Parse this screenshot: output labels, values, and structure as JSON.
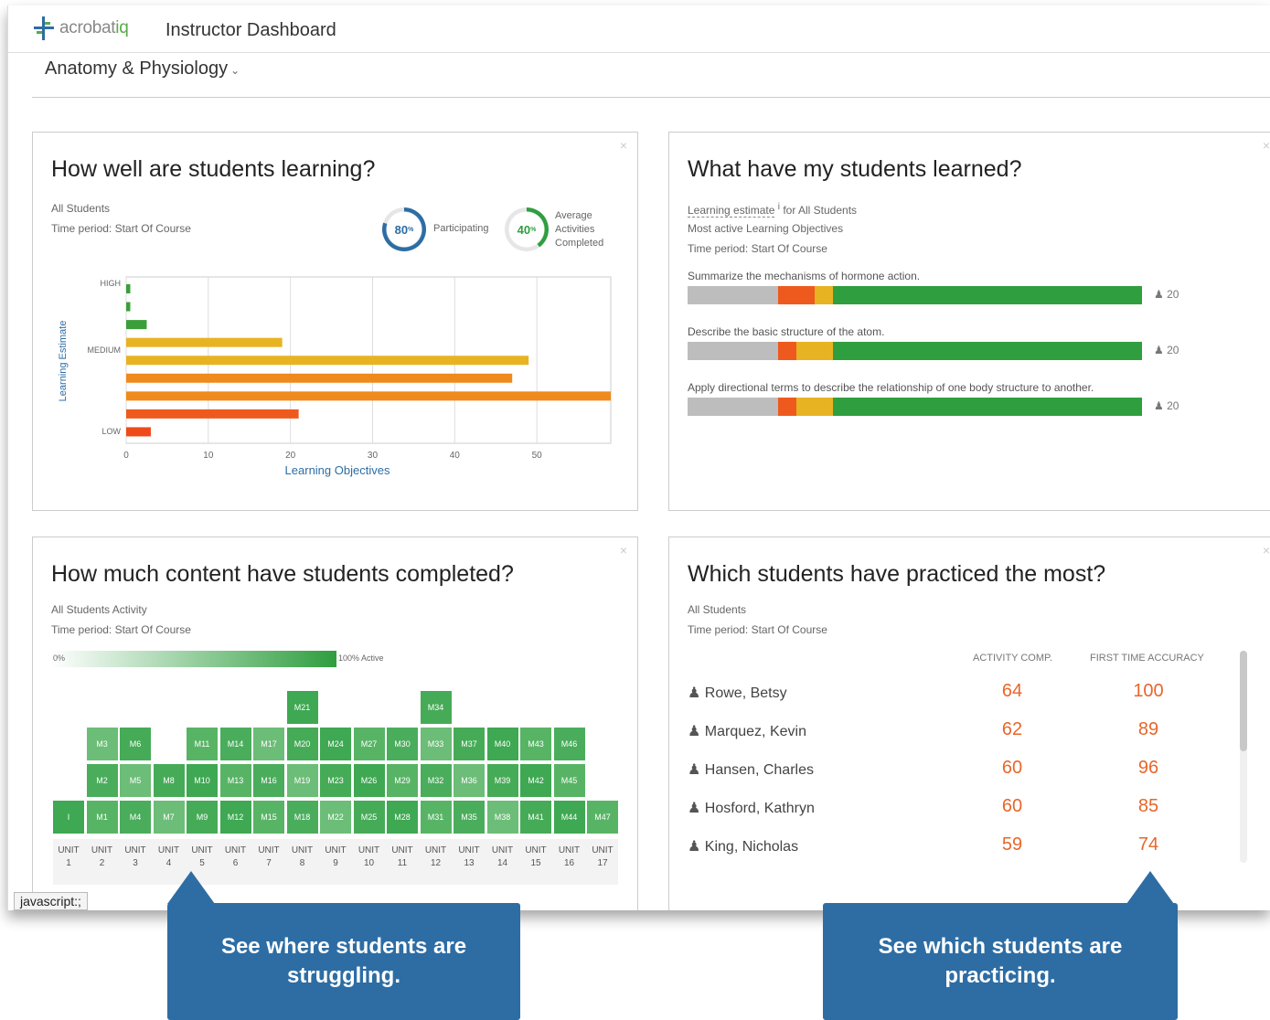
{
  "header": {
    "logo_text_a": "acrobat",
    "logo_text_b": "iq",
    "app_title": "Instructor Dashboard",
    "course": "Anatomy & Physiology",
    "course_caret": "⌄"
  },
  "learning_panel": {
    "title": "How well are students learning?",
    "filter": "All Students",
    "period": "Time period: Start Of Course",
    "participating": {
      "value": "80",
      "unit": "%",
      "label": "Participating",
      "fraction": 0.8
    },
    "activities": {
      "value": "40",
      "unit": "%",
      "label": "Average Activities Completed",
      "fraction": 0.4
    },
    "close": "×"
  },
  "chart_data": {
    "type": "bar",
    "orientation": "horizontal",
    "xlabel": "Learning Objectives",
    "ylabel": "Learning Estimate",
    "x_ticks": [
      "0",
      "10",
      "20",
      "30",
      "40",
      "50"
    ],
    "xlim": [
      0,
      59
    ],
    "y_tick_labels": [
      "HIGH",
      "MEDIUM",
      "LOW"
    ],
    "grid": true,
    "bars": [
      {
        "value": 0.5,
        "color": "#3a9f3a"
      },
      {
        "value": 0.5,
        "color": "#3a9f3a"
      },
      {
        "value": 2.5,
        "color": "#3a9f3a"
      },
      {
        "value": 19,
        "color": "#e8b323"
      },
      {
        "value": 49,
        "color": "#e8b323"
      },
      {
        "value": 47,
        "color": "#f08a1c"
      },
      {
        "value": 59,
        "color": "#f08a1c"
      },
      {
        "value": 21,
        "color": "#ee5a1e"
      },
      {
        "value": 3,
        "color": "#ee4a1a"
      }
    ]
  },
  "learned_panel": {
    "title": "What have my students learned?",
    "estimate_label": "Learning estimate",
    "info": "i",
    "for_label": "for All Students",
    "subtitle": "Most active Learning Objectives",
    "period": "Time period: Start Of Course",
    "close": "×",
    "objectives": [
      {
        "label": "Summarize the mechanisms of hormone action.",
        "count": "20",
        "segments": [
          0.2,
          0.08,
          0.04,
          0.68
        ]
      },
      {
        "label": "Describe the basic structure of the atom.",
        "count": "20",
        "segments": [
          0.2,
          0.04,
          0.08,
          0.68
        ]
      },
      {
        "label": "Apply directional terms to describe the relationship of one body structure to another.",
        "count": "20",
        "segments": [
          0.2,
          0.04,
          0.08,
          0.68
        ]
      }
    ],
    "segment_colors": [
      "#bdbdbd",
      "#ee5a1e",
      "#e8b323",
      "#2f9e3f"
    ]
  },
  "content_panel": {
    "title": "How much content have students completed?",
    "filter": "All Students Activity",
    "period": "Time period: Start Of Course",
    "legend_min": "0%",
    "legend_max": "100% Active",
    "close": "×",
    "units": [
      {
        "label": "UNIT",
        "num": "1",
        "modules": [
          "I"
        ]
      },
      {
        "label": "UNIT",
        "num": "2",
        "modules": [
          "M1",
          "M2",
          "M3"
        ]
      },
      {
        "label": "UNIT",
        "num": "3",
        "modules": [
          "M4",
          "M5",
          "M6"
        ]
      },
      {
        "label": "UNIT",
        "num": "4",
        "modules": [
          "M7",
          "M8"
        ]
      },
      {
        "label": "UNIT",
        "num": "5",
        "modules": [
          "M9",
          "M10",
          "M11"
        ]
      },
      {
        "label": "UNIT",
        "num": "6",
        "modules": [
          "M12",
          "M13",
          "M14"
        ]
      },
      {
        "label": "UNIT",
        "num": "7",
        "modules": [
          "M15",
          "M16",
          "M17"
        ]
      },
      {
        "label": "UNIT",
        "num": "8",
        "modules": [
          "M18",
          "M19",
          "M20",
          "M21"
        ]
      },
      {
        "label": "UNIT",
        "num": "9",
        "modules": [
          "M22",
          "M23",
          "M24"
        ]
      },
      {
        "label": "UNIT",
        "num": "10",
        "modules": [
          "M25",
          "M26",
          "M27"
        ]
      },
      {
        "label": "UNIT",
        "num": "11",
        "modules": [
          "M28",
          "M29",
          "M30"
        ]
      },
      {
        "label": "UNIT",
        "num": "12",
        "modules": [
          "M31",
          "M32",
          "M33",
          "M34"
        ]
      },
      {
        "label": "UNIT",
        "num": "13",
        "modules": [
          "M35",
          "M36",
          "M37"
        ]
      },
      {
        "label": "UNIT",
        "num": "14",
        "modules": [
          "M38",
          "M39",
          "M40"
        ]
      },
      {
        "label": "UNIT",
        "num": "15",
        "modules": [
          "M41",
          "M42",
          "M43"
        ]
      },
      {
        "label": "UNIT",
        "num": "16",
        "modules": [
          "M44",
          "M45",
          "M46"
        ]
      },
      {
        "label": "UNIT",
        "num": "17",
        "modules": [
          "M47"
        ]
      }
    ]
  },
  "practice_panel": {
    "title": "Which students have practiced the most?",
    "filter": "All Students",
    "period": "Time period: Start Of Course",
    "col_activity": "ACTIVITY COMP.",
    "col_accuracy": "FIRST TIME ACCURACY",
    "close": "×",
    "students": [
      {
        "name": "Rowe, Betsy",
        "activity": "64",
        "accuracy": "100"
      },
      {
        "name": "Marquez, Kevin",
        "activity": "62",
        "accuracy": "89"
      },
      {
        "name": "Hansen, Charles",
        "activity": "60",
        "accuracy": "96"
      },
      {
        "name": "Hosford, Kathryn",
        "activity": "60",
        "accuracy": "85"
      },
      {
        "name": "King, Nicholas",
        "activity": "59",
        "accuracy": "74"
      }
    ]
  },
  "statusbar": {
    "text": "javascript:;"
  },
  "callouts": {
    "left": "See where students are struggling.",
    "right": "See which students are practicing."
  },
  "icons": {
    "person": "person-icon",
    "info": "info-icon",
    "close": "close-icon"
  }
}
